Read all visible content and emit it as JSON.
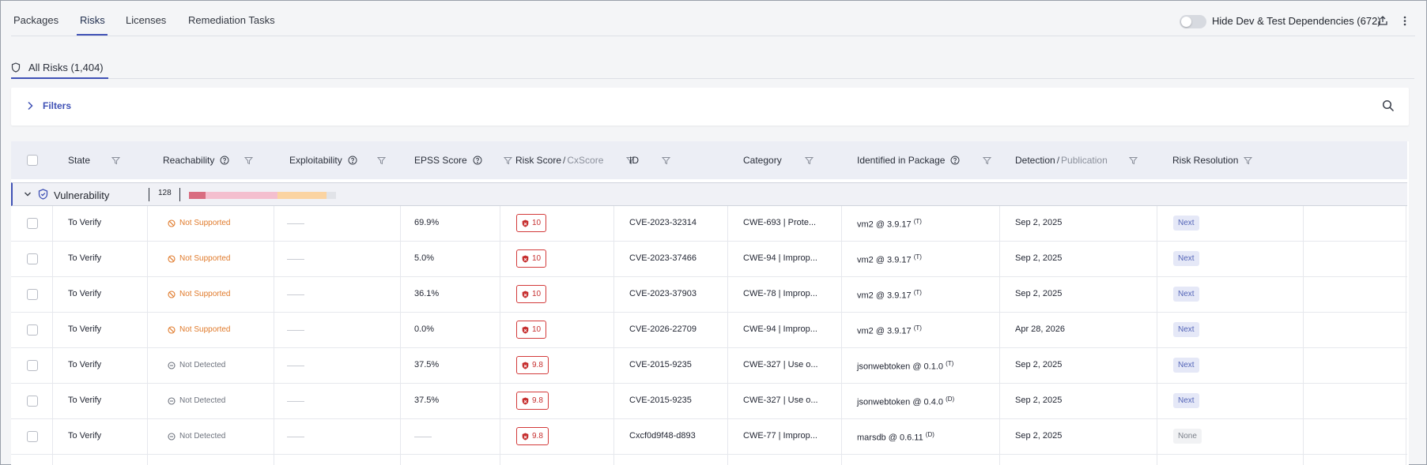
{
  "top_tabs": [
    "Packages",
    "Risks",
    "Licenses",
    "Remediation Tasks"
  ],
  "active_tab": "Risks",
  "toggle": {
    "label": "Hide Dev & Test Dependencies (672)",
    "on": false
  },
  "top_icons": [
    "export-icon",
    "more-vert-icon"
  ],
  "all_risks": {
    "label": "All Risks (1,404)"
  },
  "filters": {
    "label": "Filters"
  },
  "columns": {
    "state": "State",
    "reachability": "Reachability",
    "exploitability": "Exploitability",
    "epss": "EPSS Score",
    "risk_score": "Risk Score",
    "cx_score": "CxScore",
    "id": "ID",
    "category": "Category",
    "identified_in_package": "Identified in Package",
    "detection": "Detection",
    "publication": "Publication",
    "risk_resolution": "Risk Resolution"
  },
  "group": {
    "label": "Vulnerability",
    "count": "128",
    "severity_bar": [
      {
        "fraction": 0.114,
        "color": "#d96c80"
      },
      {
        "fraction": 0.491,
        "color": "#f4bfcf"
      },
      {
        "fraction": 0.333,
        "color": "#fbd4a2"
      },
      {
        "fraction": 0.062,
        "color": "#e1e3e8"
      }
    ]
  },
  "rows": [
    {
      "state": "To Verify",
      "reachability": "Not Supported",
      "reach_type": "ns",
      "epss": "69.9%",
      "score": "10",
      "id": "CVE-2023-32314",
      "category": "CWE-693 | Prote...",
      "package": "vm2 @ 3.9.17",
      "pkg_tag": "(T)",
      "detection": "Sep 2, 2025",
      "resolution": "Next"
    },
    {
      "state": "To Verify",
      "reachability": "Not Supported",
      "reach_type": "ns",
      "epss": "5.0%",
      "score": "10",
      "id": "CVE-2023-37466",
      "category": "CWE-94 | Improp...",
      "package": "vm2 @ 3.9.17",
      "pkg_tag": "(T)",
      "detection": "Sep 2, 2025",
      "resolution": "Next"
    },
    {
      "state": "To Verify",
      "reachability": "Not Supported",
      "reach_type": "ns",
      "epss": "36.1%",
      "score": "10",
      "id": "CVE-2023-37903",
      "category": "CWE-78 | Improp...",
      "package": "vm2 @ 3.9.17",
      "pkg_tag": "(T)",
      "detection": "Sep 2, 2025",
      "resolution": "Next"
    },
    {
      "state": "To Verify",
      "reachability": "Not Supported",
      "reach_type": "ns",
      "epss": "0.0%",
      "score": "10",
      "id": "CVE-2026-22709",
      "category": "CWE-94 | Improp...",
      "package": "vm2 @ 3.9.17",
      "pkg_tag": "(T)",
      "detection": "Apr 28, 2026",
      "resolution": "Next"
    },
    {
      "state": "To Verify",
      "reachability": "Not Detected",
      "reach_type": "nd",
      "epss": "37.5%",
      "score": "9.8",
      "id": "CVE-2015-9235",
      "category": "CWE-327 | Use o...",
      "package": "jsonwebtoken @ 0.1.0",
      "pkg_tag": "(T)",
      "detection": "Sep 2, 2025",
      "resolution": "Next"
    },
    {
      "state": "To Verify",
      "reachability": "Not Detected",
      "reach_type": "nd",
      "epss": "37.5%",
      "score": "9.8",
      "id": "CVE-2015-9235",
      "category": "CWE-327 | Use o...",
      "package": "jsonwebtoken @ 0.4.0",
      "pkg_tag": "(D)",
      "detection": "Sep 2, 2025",
      "resolution": "Next"
    },
    {
      "state": "To Verify",
      "reachability": "Not Detected",
      "reach_type": "nd",
      "epss": "",
      "score": "9.8",
      "id": "Cxcf0d9f48-d893",
      "category": "CWE-77 | Improp...",
      "package": "marsdb @ 0.6.11",
      "pkg_tag": "(D)",
      "detection": "Sep 2, 2025",
      "resolution": "None"
    }
  ]
}
